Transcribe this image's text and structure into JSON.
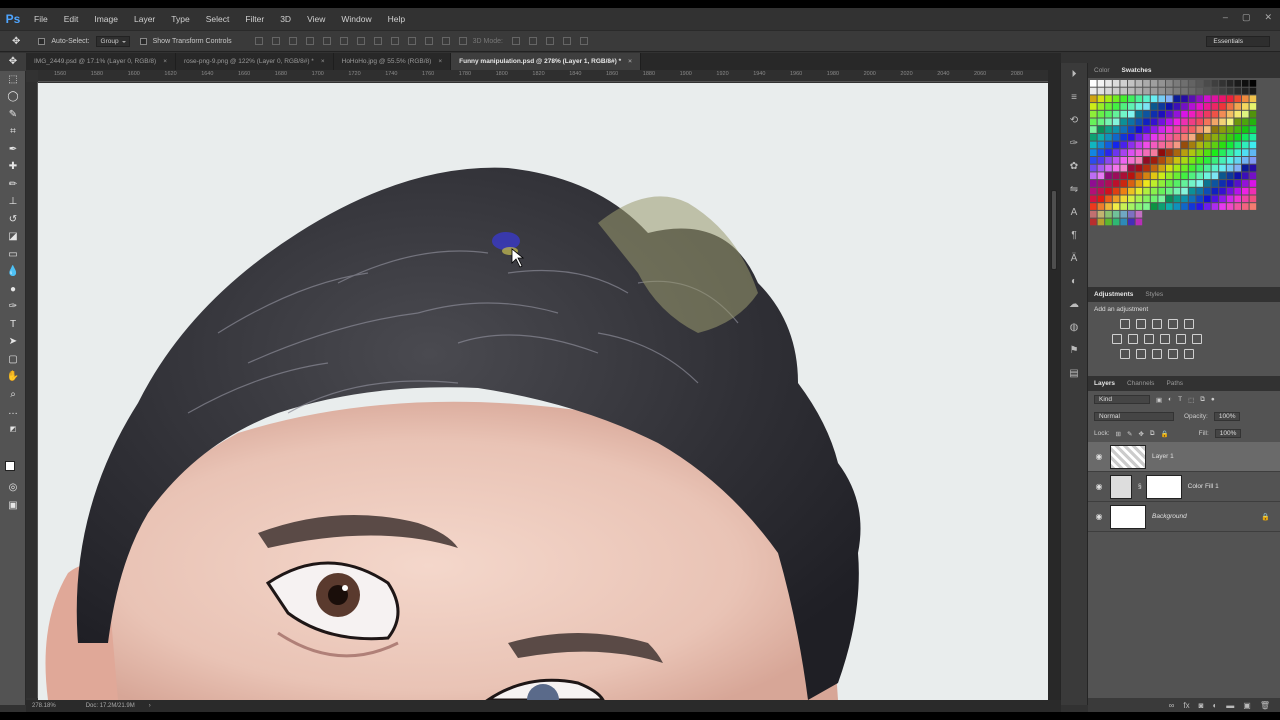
{
  "app": {
    "logo": "Ps"
  },
  "menu": [
    "File",
    "Edit",
    "Image",
    "Layer",
    "Type",
    "Select",
    "Filter",
    "3D",
    "View",
    "Window",
    "Help"
  ],
  "window_controls": [
    "–",
    "▢",
    "✕"
  ],
  "options": {
    "auto_select_label": "Auto-Select:",
    "auto_select_value": "Group",
    "transform_label": "Show Transform Controls",
    "mode_3d": "3D Mode:",
    "workspace": "Essentials"
  },
  "tabs": [
    {
      "label": "IMG_2449.psd @ 17.1% (Layer 0, RGB/8)",
      "close": "×"
    },
    {
      "label": "rose-png-9.png @ 122% (Layer 0, RGB/8#) *",
      "close": "×"
    },
    {
      "label": "HoHoHo.jpg @ 55.5% (RGB/8)",
      "close": "×"
    },
    {
      "label": "Funny manipulation.psd @ 278% (Layer 1, RGB/8#) *",
      "close": "×"
    }
  ],
  "ruler": [
    "1560",
    "1580",
    "1600",
    "1620",
    "1640",
    "1660",
    "1680",
    "1700",
    "1720",
    "1740",
    "1760",
    "1780",
    "1800",
    "1820",
    "1840",
    "1860",
    "1880",
    "1900",
    "1920",
    "1940",
    "1960",
    "1980",
    "2000",
    "2020",
    "2040",
    "2060",
    "2080"
  ],
  "status": {
    "zoom": "278.18%",
    "doc": "Doc: 17.2M/21.9M"
  },
  "swatch_panel": {
    "tabs": [
      "Color",
      "Swatches"
    ],
    "active": "Swatches"
  },
  "adjustments": {
    "tabs": [
      "Adjustments",
      "Styles"
    ],
    "active": "Adjustments",
    "hint": "Add an adjustment"
  },
  "layers_panel": {
    "tabs": [
      "Layers",
      "Channels",
      "Paths"
    ],
    "active": "Layers",
    "kind": "Kind",
    "blend": "Normal",
    "opacity_label": "Opacity:",
    "opacity": "100%",
    "lock_label": "Lock:",
    "fill_label": "Fill:",
    "fill": "100%",
    "layers": [
      {
        "name": "Layer 1",
        "selected": true
      },
      {
        "name": "Color Fill 1",
        "selected": false
      },
      {
        "name": "Background",
        "selected": false,
        "locked": true
      }
    ]
  }
}
